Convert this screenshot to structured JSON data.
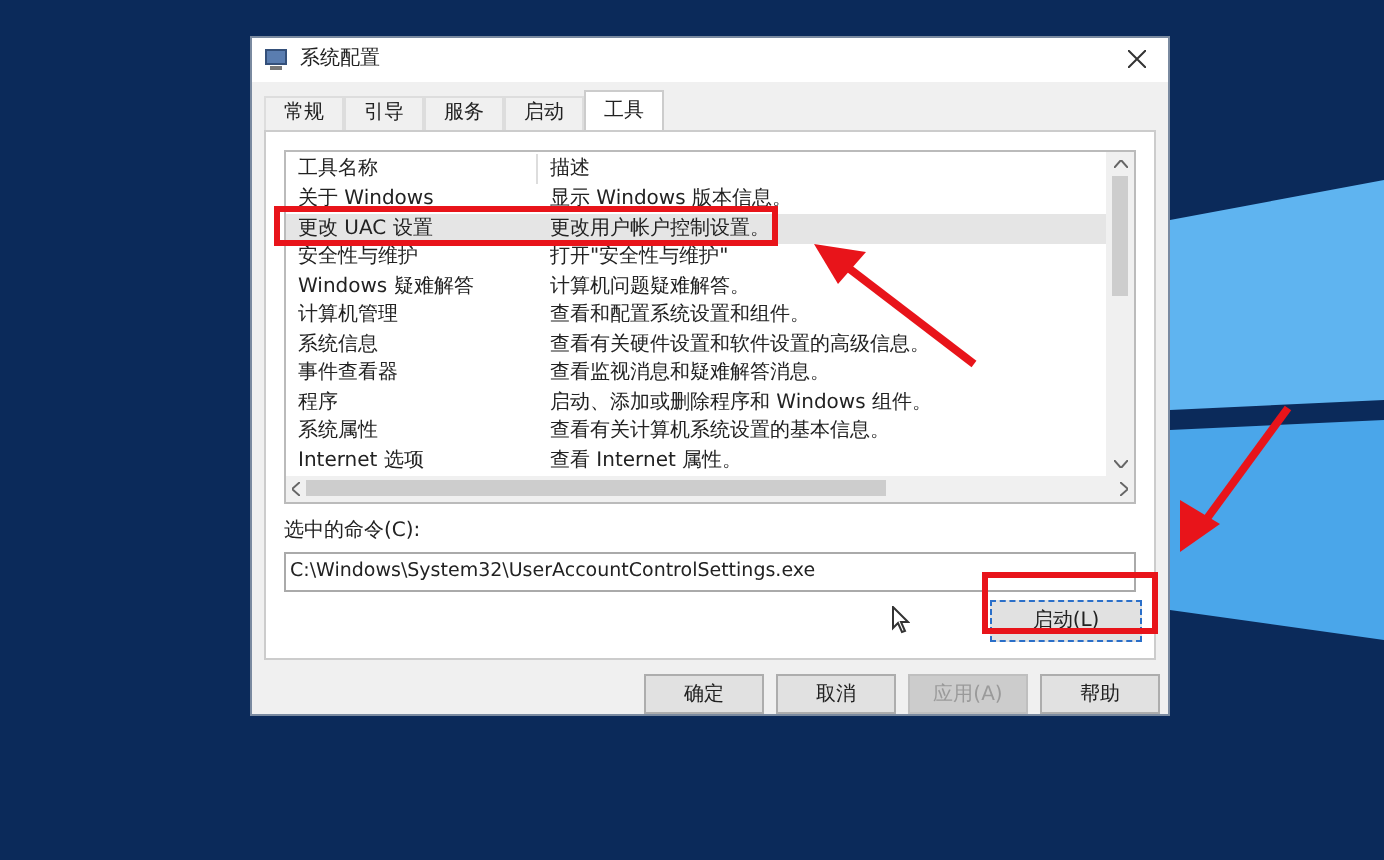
{
  "window": {
    "title": "系统配置"
  },
  "tabs": [
    {
      "label": "常规",
      "selected": false
    },
    {
      "label": "引导",
      "selected": false
    },
    {
      "label": "服务",
      "selected": false
    },
    {
      "label": "启动",
      "selected": false
    },
    {
      "label": "工具",
      "selected": true
    }
  ],
  "table": {
    "columns": [
      "工具名称",
      "描述"
    ],
    "rows": [
      {
        "name": "关于 Windows",
        "description": "显示 Windows 版本信息。",
        "selected": false
      },
      {
        "name": "更改 UAC 设置",
        "description": "更改用户帐户控制设置。",
        "selected": true
      },
      {
        "name": "安全性与维护",
        "description": "打开\"安全性与维护\"",
        "selected": false
      },
      {
        "name": "Windows 疑难解答",
        "description": "计算机问题疑难解答。",
        "selected": false
      },
      {
        "name": "计算机管理",
        "description": "查看和配置系统设置和组件。",
        "selected": false
      },
      {
        "name": "系统信息",
        "description": "查看有关硬件设置和软件设置的高级信息。",
        "selected": false
      },
      {
        "name": "事件查看器",
        "description": "查看监视消息和疑难解答消息。",
        "selected": false
      },
      {
        "name": "程序",
        "description": "启动、添加或删除程序和 Windows 组件。",
        "selected": false
      },
      {
        "name": "系统属性",
        "description": "查看有关计算机系统设置的基本信息。",
        "selected": false
      },
      {
        "name": "Internet 选项",
        "description": "查看 Internet 属性。",
        "selected": false
      }
    ]
  },
  "command": {
    "label": "选中的命令(C):",
    "value": "C:\\Windows\\System32\\UserAccountControlSettings.exe"
  },
  "launch_button": "启动(L)",
  "buttons": [
    {
      "label": "确定",
      "disabled": false
    },
    {
      "label": "取消",
      "disabled": false
    },
    {
      "label": "应用(A)",
      "disabled": true
    },
    {
      "label": "帮助",
      "disabled": false
    }
  ]
}
